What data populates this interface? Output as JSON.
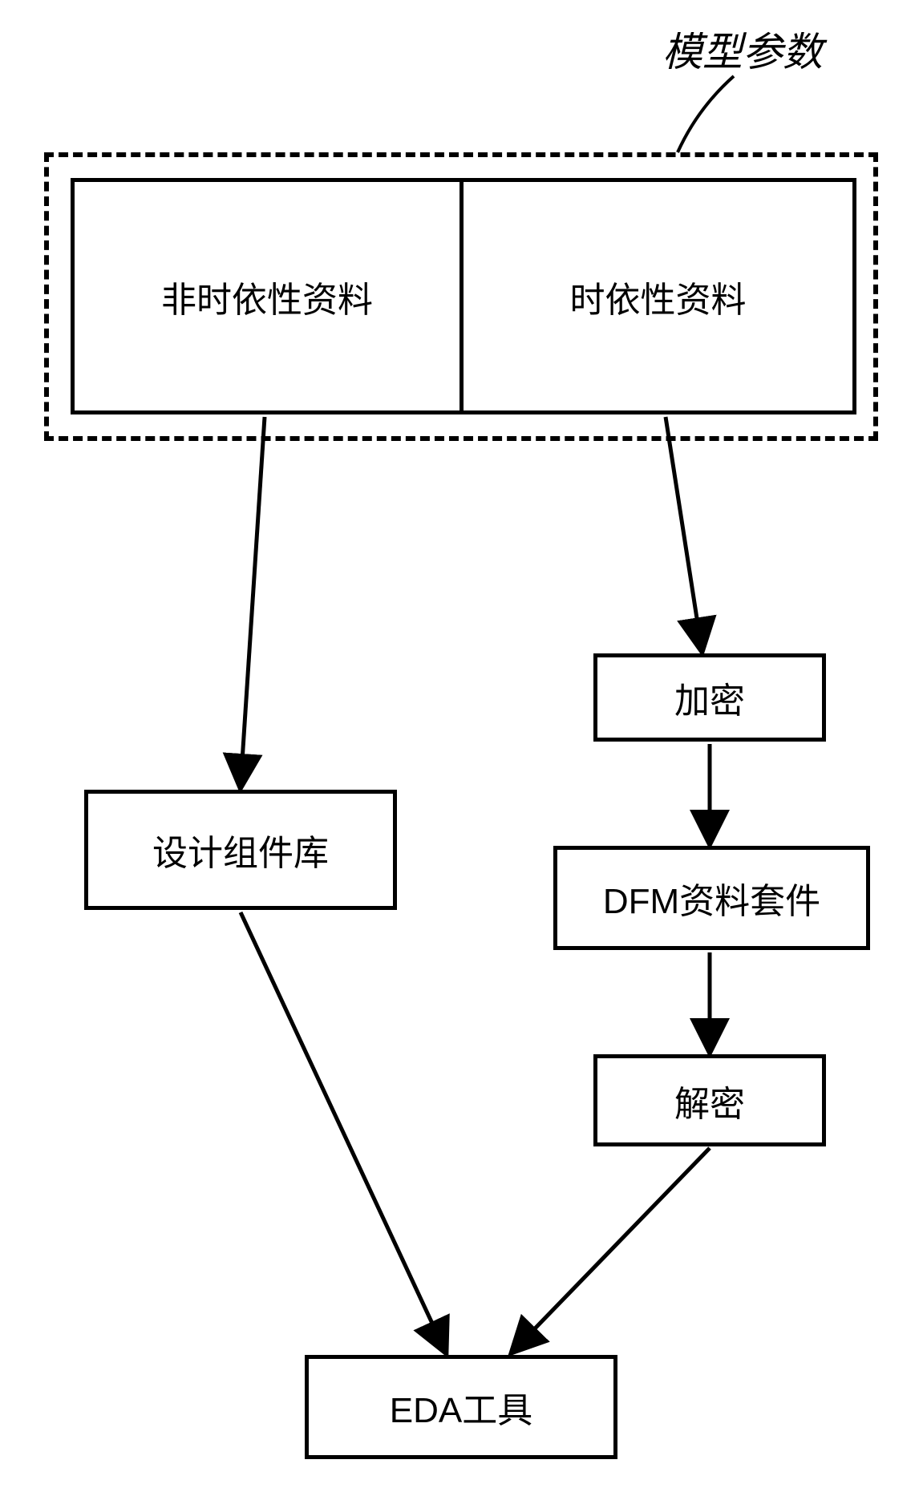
{
  "title": "模型参数",
  "boxes": {
    "nontime": "非时依性资料",
    "time": "时依性资料",
    "encrypt": "加密",
    "design_lib": "设计组件库",
    "dfm": "DFM资料套件",
    "decrypt": "解密",
    "eda": "EDA工具"
  }
}
